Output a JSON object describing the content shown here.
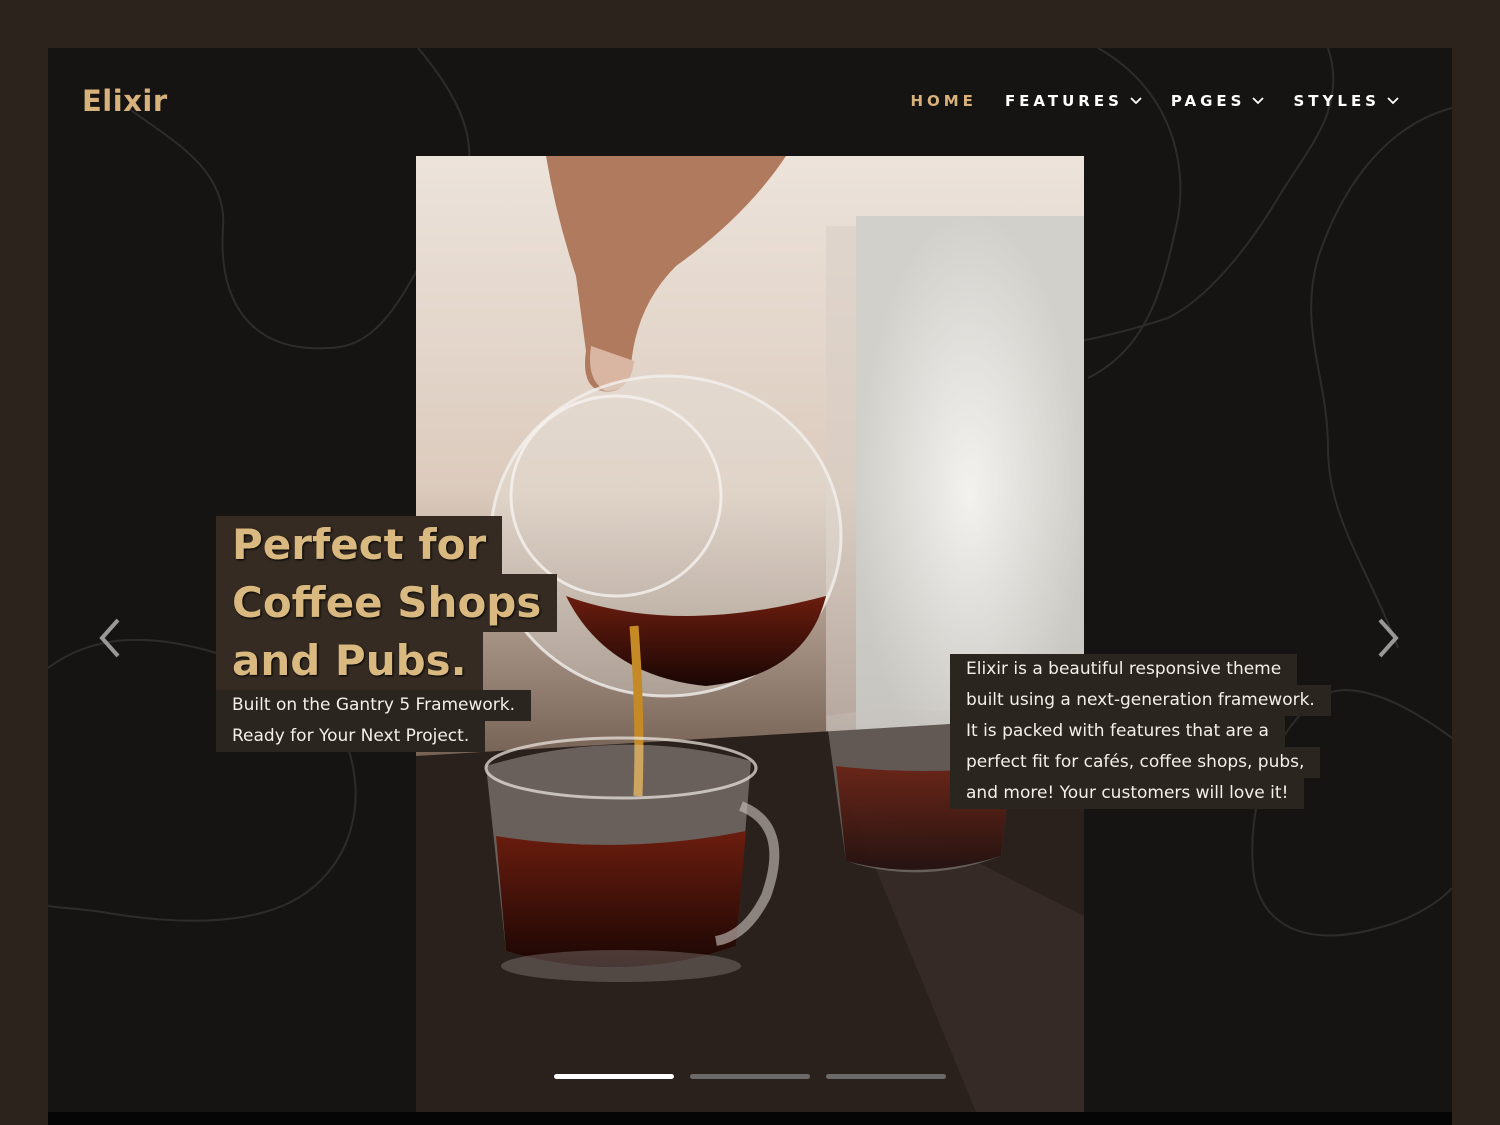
{
  "logo": {
    "text": "Elixir"
  },
  "nav": {
    "items": [
      {
        "label": "HOME",
        "active": true,
        "dropdown": false
      },
      {
        "label": "FEATURES",
        "active": false,
        "dropdown": true
      },
      {
        "label": "PAGES",
        "active": false,
        "dropdown": true
      },
      {
        "label": "STYLES",
        "active": false,
        "dropdown": true
      }
    ]
  },
  "hero": {
    "headline": [
      "Perfect for",
      "Coffee Shops",
      "and Pubs."
    ],
    "subtitle": [
      "Built on the Gantry 5 Framework.",
      "Ready for Your Next Project."
    ],
    "description": [
      "Elixir is a beautiful responsive theme",
      "built using a next-generation framework.",
      "It is packed with features that are a",
      "perfect fit for cafés, coffee shops, pubs,",
      "and more! Your customers will love it!"
    ]
  },
  "slider": {
    "slide_count": 3,
    "active_index": 0
  },
  "colors": {
    "accent": "#d8b27a",
    "outer_background": "#2b231c",
    "frame_background": "#151413",
    "text_box": "#2b2520"
  }
}
